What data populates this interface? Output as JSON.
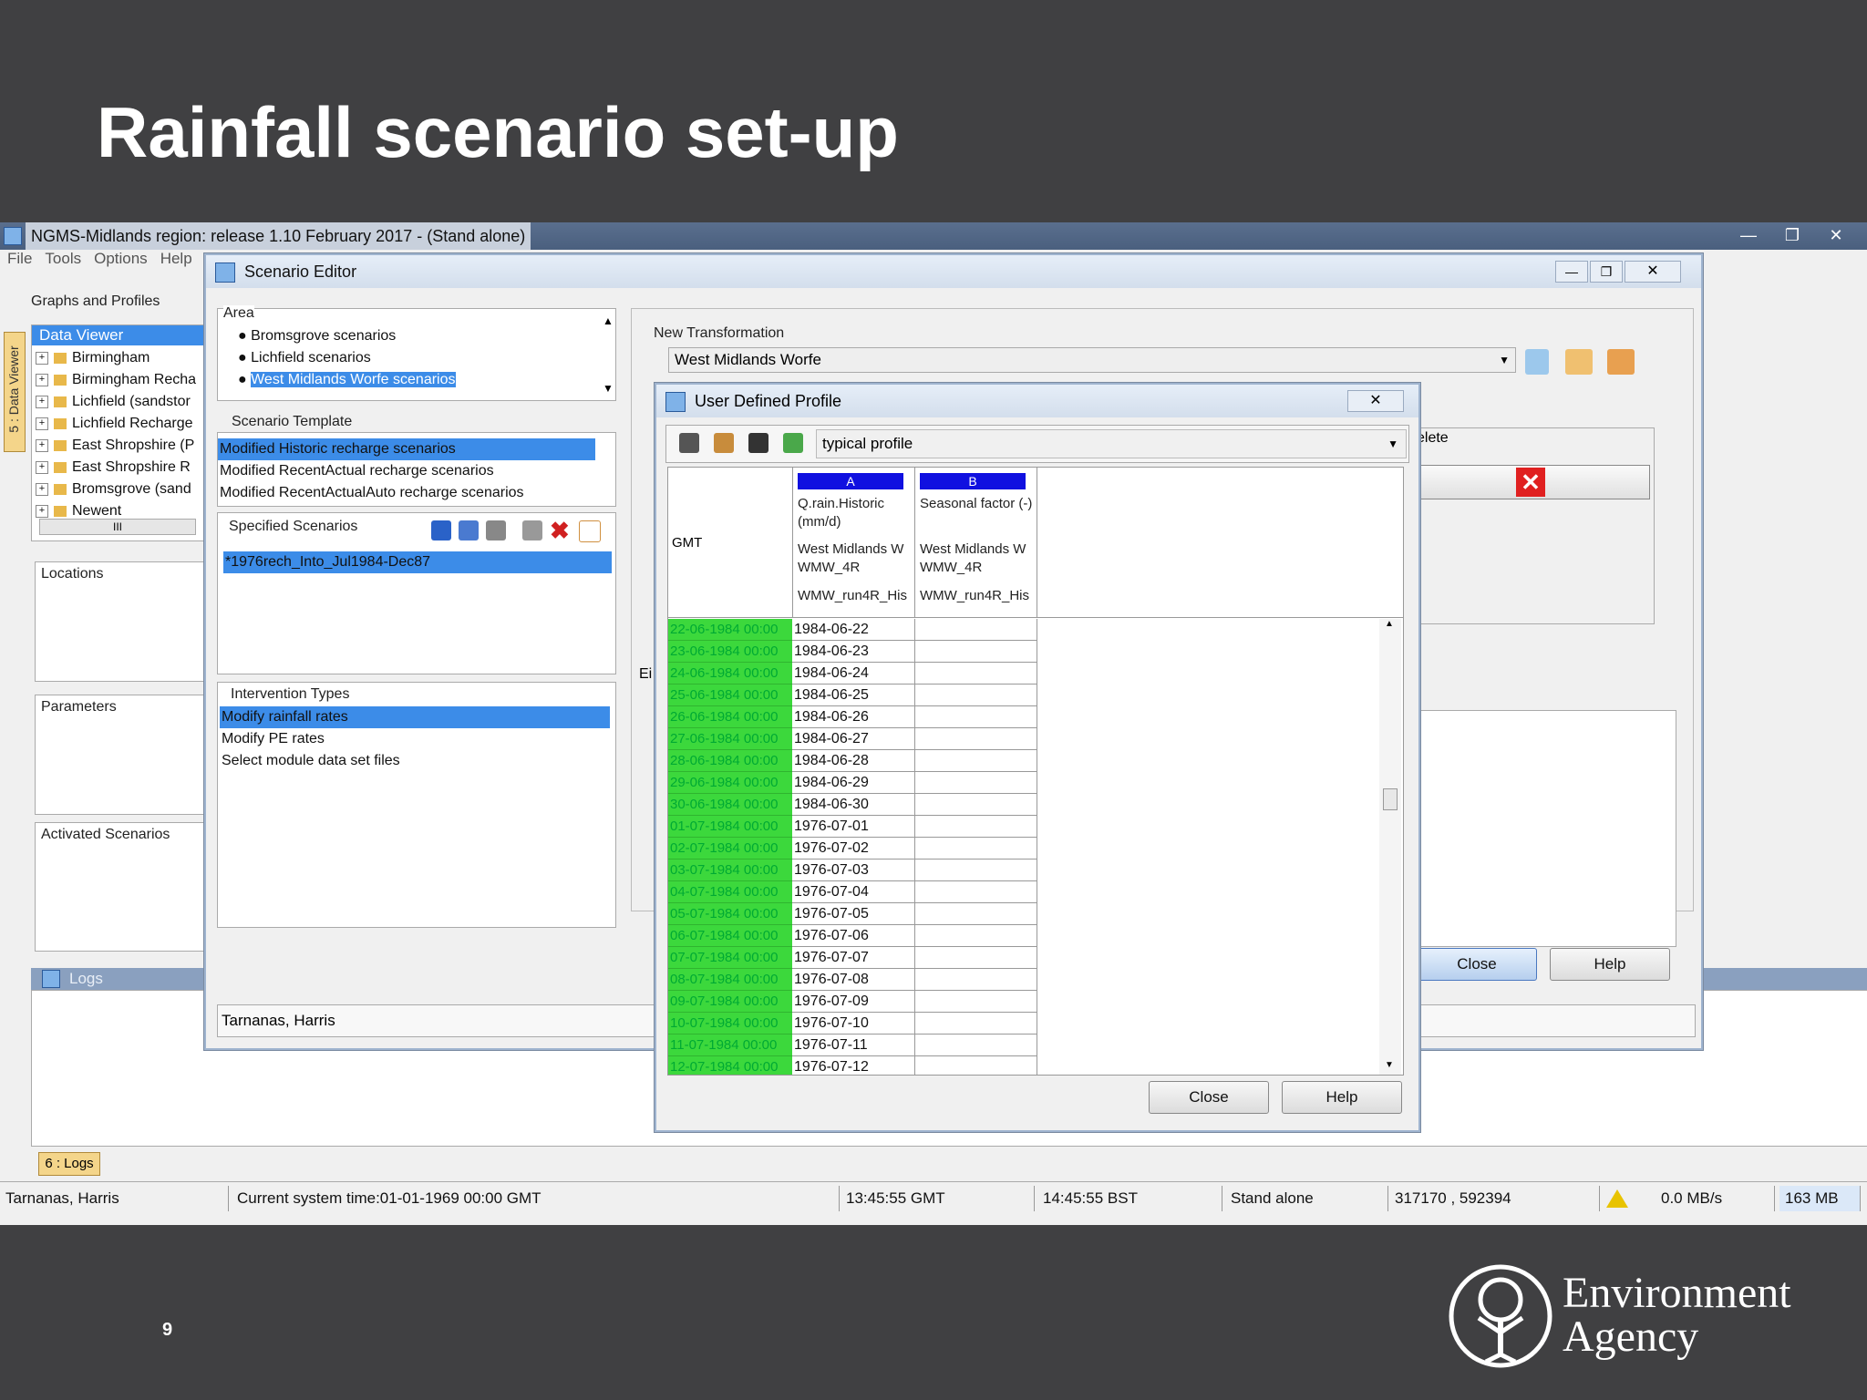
{
  "slide": {
    "title": "Rainfall scenario set-up",
    "page_number": "9",
    "logo_line1": "Environment",
    "logo_line2": "Agency"
  },
  "app": {
    "title": "NGMS-Midlands region: release 1.10 February 2017 - (Stand alone)",
    "menu": [
      "File",
      "Tools",
      "Options",
      "Help"
    ],
    "left_panel_title": "Graphs and Profiles",
    "side_tab": "5 : Data Viewer",
    "data_viewer_label": "Data Viewer",
    "tree_items": [
      "Birmingham",
      "Birmingham Recha",
      "Lichfield (sandstor",
      "Lichfield Recharge",
      "East Shropshire (P",
      "East Shropshire R",
      "Bromsgrove (sand",
      "Newent"
    ],
    "tree_scroll": "III",
    "locations_label": "Locations",
    "parameters_label": "Parameters",
    "activated_label": "Activated Scenarios",
    "logs_label": "Logs",
    "logs_tab": "6 : Logs"
  },
  "scenario_editor": {
    "title": "Scenario Editor",
    "area_label": "Area",
    "area_items": [
      "Bromsgrove scenarios",
      "Lichfield scenarios",
      "West Midlands Worfe scenarios"
    ],
    "template_label": "Scenario Template",
    "template_items": [
      "Modified Historic recharge scenarios",
      "Modified RecentActual recharge scenarios",
      "Modified RecentActualAuto recharge scenarios"
    ],
    "specified_label": "Specified Scenarios",
    "specified_items": [
      "*1976rech_Into_Jul1984-Dec87"
    ],
    "intervention_label": "Intervention Types",
    "intervention_items": [
      "Modify rainfall rates",
      "Modify PE rates",
      "Select module data set files"
    ],
    "new_transformation_label": "New Transformation",
    "transformation_value": "West Midlands Worfe",
    "delete_label": "elete",
    "cut_label": "Ei",
    "user": "Tarnanas, Harris",
    "close": "Close",
    "help": "Help"
  },
  "udp": {
    "title": "User Defined Profile",
    "profile_select": "typical profile",
    "gmt_label": "GMT",
    "col_a": {
      "letter": "A",
      "param": "Q.rain.Historic (mm/d)",
      "loc": "West Midlands W WMW_4R",
      "module": "WMW_run4R_His"
    },
    "col_b": {
      "letter": "B",
      "param": "Seasonal factor (-)",
      "loc": "West Midlands W WMW_4R",
      "module": "WMW_run4R_His"
    },
    "rows": [
      {
        "t": "22-06-1984 00:00",
        "a": "1984-06-22"
      },
      {
        "t": "23-06-1984 00:00",
        "a": "1984-06-23"
      },
      {
        "t": "24-06-1984 00:00",
        "a": "1984-06-24"
      },
      {
        "t": "25-06-1984 00:00",
        "a": "1984-06-25"
      },
      {
        "t": "26-06-1984 00:00",
        "a": "1984-06-26"
      },
      {
        "t": "27-06-1984 00:00",
        "a": "1984-06-27"
      },
      {
        "t": "28-06-1984 00:00",
        "a": "1984-06-28"
      },
      {
        "t": "29-06-1984 00:00",
        "a": "1984-06-29"
      },
      {
        "t": "30-06-1984 00:00",
        "a": "1984-06-30"
      },
      {
        "t": "01-07-1984 00:00",
        "a": "1976-07-01"
      },
      {
        "t": "02-07-1984 00:00",
        "a": "1976-07-02"
      },
      {
        "t": "03-07-1984 00:00",
        "a": "1976-07-03"
      },
      {
        "t": "04-07-1984 00:00",
        "a": "1976-07-04"
      },
      {
        "t": "05-07-1984 00:00",
        "a": "1976-07-05"
      },
      {
        "t": "06-07-1984 00:00",
        "a": "1976-07-06"
      },
      {
        "t": "07-07-1984 00:00",
        "a": "1976-07-07"
      },
      {
        "t": "08-07-1984 00:00",
        "a": "1976-07-08"
      },
      {
        "t": "09-07-1984 00:00",
        "a": "1976-07-09"
      },
      {
        "t": "10-07-1984 00:00",
        "a": "1976-07-10"
      },
      {
        "t": "11-07-1984 00:00",
        "a": "1976-07-11"
      },
      {
        "t": "12-07-1984 00:00",
        "a": "1976-07-12"
      }
    ],
    "close": "Close",
    "help": "Help"
  },
  "status": {
    "user": "Tarnanas, Harris",
    "system_time": "Current system time:01-01-1969 00:00 GMT",
    "gmt": "13:45:55 GMT",
    "bst": "14:45:55 BST",
    "mode": "Stand alone",
    "coords": "317170 , 592394",
    "rate": "0.0 MB/s",
    "memory": "163 MB"
  },
  "colors": {
    "accent": "#3c8ce8",
    "green": "#3cd83c",
    "header_blue": "#1010e0",
    "slide_bg": "#404042"
  }
}
